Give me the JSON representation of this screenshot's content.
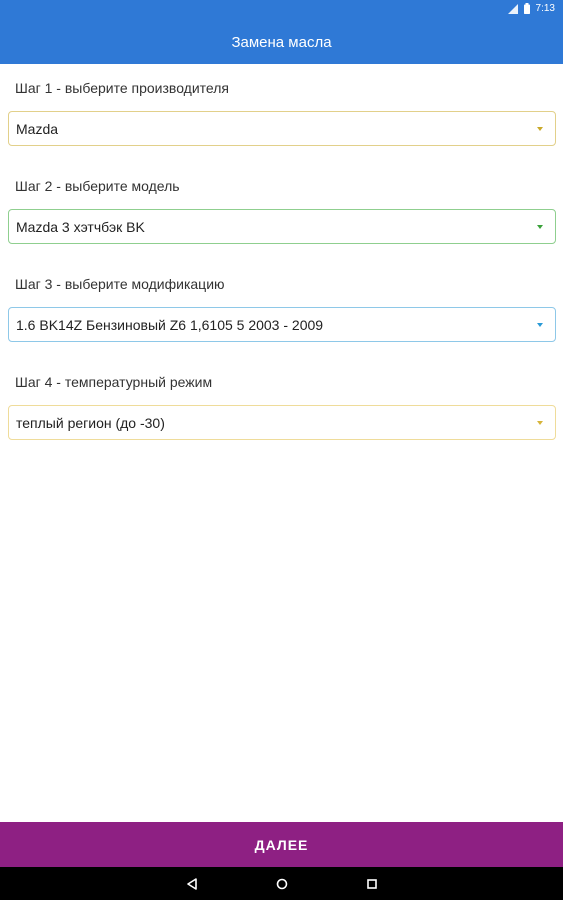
{
  "status_bar": {
    "time": "7:13"
  },
  "app_bar": {
    "title": "Замена масла"
  },
  "steps": [
    {
      "label": "Шаг 1 - выберите производителя",
      "value": "Mazda",
      "border_color": "#e2d08a",
      "caret_color": "#c9a92a"
    },
    {
      "label": "Шаг 2 - выберите модель",
      "value": "Mazda 3 хэтчбэк BK",
      "border_color": "#8fcf8f",
      "caret_color": "#3aa13a"
    },
    {
      "label": "Шаг 3 - выберите модификацию",
      "value": "1.6  BK14Z Бензиновый Z6 1,6105 5  2003 - 2009",
      "border_color": "#8ec8e8",
      "caret_color": "#2a9ad6"
    },
    {
      "label": "Шаг 4 - температурный режим",
      "value": "теплый регион (до -30)",
      "border_color": "#efdc9a",
      "caret_color": "#d6b43a"
    }
  ],
  "next_button": {
    "label": "ДАЛЕЕ",
    "color": "#8e2083"
  },
  "nav_bar": {
    "icons": [
      "back-icon",
      "home-icon",
      "recents-icon"
    ]
  },
  "colors": {
    "primary": "#2f79d6"
  }
}
